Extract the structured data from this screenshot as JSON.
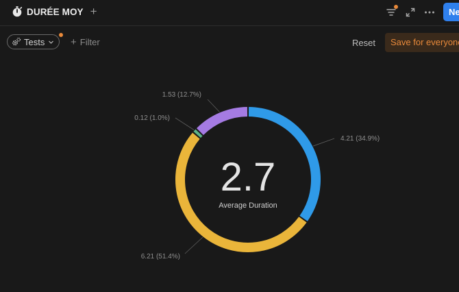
{
  "header": {
    "title": "DURÉE MOY",
    "add_view_symbol": "+",
    "new_button_label": "Ne"
  },
  "filterbar": {
    "tests_chip_label": "Tests",
    "add_filter_label": "Filter",
    "reset_label": "Reset",
    "save_label": "Save for everyone"
  },
  "summary": {
    "value": "2.7",
    "label": "Average Duration"
  },
  "chart_data": {
    "type": "pie",
    "style": "donut",
    "title": "",
    "slices": [
      {
        "value": 4.21,
        "percent": 34.9,
        "label": "4.21 (34.9%)",
        "color": "#2f9ae8"
      },
      {
        "value": 6.21,
        "percent": 51.4,
        "label": "6.21 (51.4%)",
        "color": "#eab53a"
      },
      {
        "value": 0.12,
        "percent": 1.0,
        "label": "0.12 (1.0%)",
        "color": "#5cb388"
      },
      {
        "value": 1.53,
        "percent": 12.7,
        "label": "1.53 (12.7%)",
        "color": "#a57be3"
      }
    ]
  },
  "colors": {
    "background": "#191919",
    "accent_blue": "#2f80ed",
    "accent_orange": "#e8893a"
  }
}
